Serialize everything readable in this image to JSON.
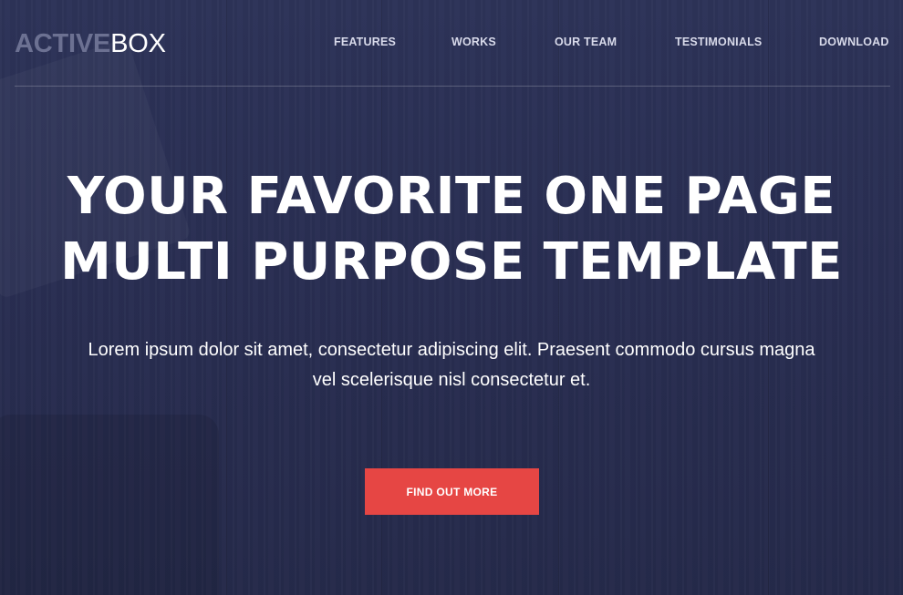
{
  "brand": {
    "logo_strong": "ACTIVE",
    "logo_light": "BOX"
  },
  "nav": {
    "items": [
      {
        "label": "FEATURES"
      },
      {
        "label": "WORKS"
      },
      {
        "label": "OUR TEAM"
      },
      {
        "label": "TESTIMONIALS"
      },
      {
        "label": "DOWNLOAD"
      }
    ]
  },
  "hero": {
    "title_line_1": "YOUR FAVORITE ONE PAGE",
    "title_line_2": "MULTI PURPOSE TEMPLATE",
    "text_line_1": "Lorem ipsum dolor sit amet, consectetur adipiscing elit. Praesent commodo cursus magna",
    "text_line_2": "vel scelerisque nisl consectetur et.",
    "cta_label": "FIND OUT MORE"
  },
  "colors": {
    "background": "#262b4c",
    "accent": "#e64644",
    "logo_muted": "#6c7192",
    "text": "#ffffff"
  }
}
